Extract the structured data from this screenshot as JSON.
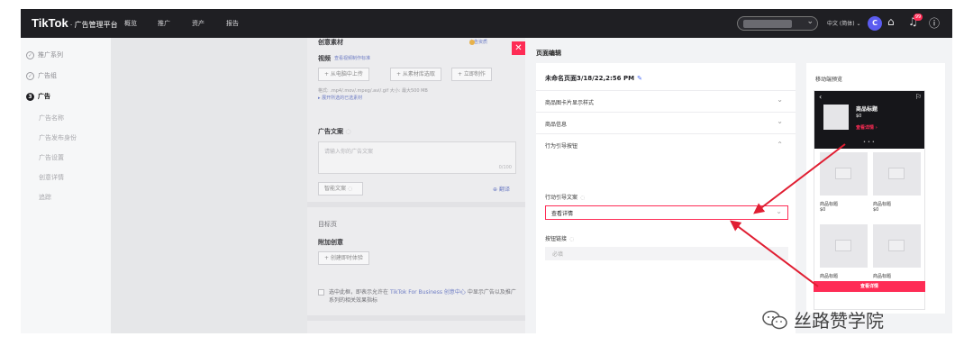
{
  "topbar": {
    "brand": "TikTok",
    "brand_sub": "· 广告管理平台",
    "nav": [
      "概览",
      "推广",
      "资产",
      "报告"
    ],
    "language": "中文 (简体)",
    "avatar_initial": "C",
    "notification_count": "99"
  },
  "sidebar": {
    "steps": [
      {
        "label": "推广系列",
        "state": "done"
      },
      {
        "label": "广告组",
        "state": "done"
      },
      {
        "label": "广告",
        "state": "active",
        "index": "3"
      }
    ],
    "sub_items": [
      "广告名称",
      "广告发布身份",
      "广告设置",
      "创意详情",
      "追踪"
    ]
  },
  "form": {
    "top_label": "创意素材",
    "top_link": "广告资质",
    "video_label": "视频",
    "video_link": "查看视频制作标准",
    "upload_local": "+ 从电脑中上传",
    "from_library": "+ 从素材库选取",
    "create_now": "+ 立即制作",
    "formats_hint": "格式: .mp4/.mov/.mpeg/.avi/.gif  大小: 最大500 MB",
    "more_link": "▸ 展开所选的已选素材",
    "ad_text_label": "广告文案",
    "ad_text_placeholder": "请输入你的广告文案",
    "char_count": "0/100",
    "smart_text": "智能文案",
    "translate": "翻译",
    "landing_label": "目标页",
    "addon_label": "附加创意",
    "create_instant": "+ 创建即时体验",
    "consent_text_1": "选中此框，即表示允许在",
    "consent_link": "TikTok For Business 创意中心",
    "consent_text_2": "中显示广告以及推广系列的相关效果指标"
  },
  "page_settings": {
    "title": "页面编辑",
    "page_name": "未命名页面3/18/22,2:56 PM",
    "accordions": [
      "商品图卡片显示样式",
      "商品信息",
      "行为引导按钮"
    ],
    "cta_text_label": "行动引导文案",
    "cta_value": "查看详情",
    "button_link_label": "按钮链接",
    "button_link_placeholder": "必填"
  },
  "preview": {
    "title": "移动端预览",
    "product_name": "商品标题",
    "product_price": "$0",
    "product_cta": "查看详情 ›",
    "items": [
      {
        "name": "商品标题",
        "price": "$0"
      },
      {
        "name": "商品标题",
        "price": "$0"
      },
      {
        "name": "商品标题",
        "price": ""
      },
      {
        "name": "商品标题",
        "price": ""
      }
    ],
    "bottom_button": "查看详情"
  },
  "watermark": "丝路赞学院",
  "colors": {
    "accent": "#fe2c55",
    "topbar": "#1f1f23",
    "link": "#4a6cf7"
  }
}
